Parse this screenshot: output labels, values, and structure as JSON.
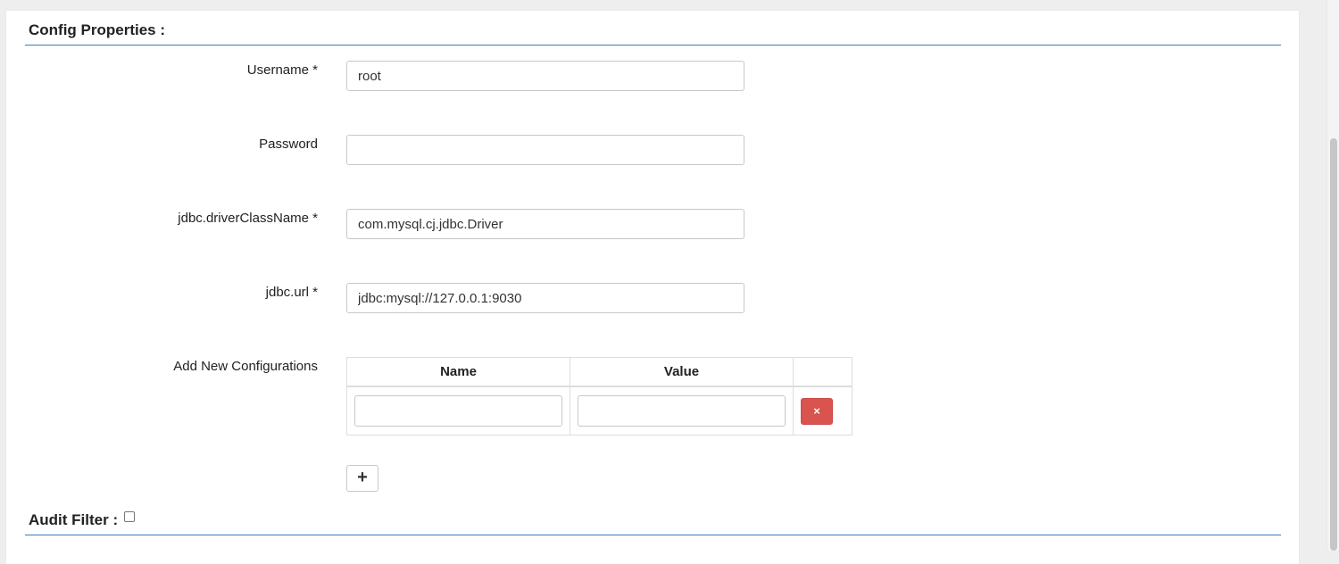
{
  "sections": {
    "config_title": "Config Properties :",
    "audit_title": "Audit Filter :"
  },
  "form": {
    "username": {
      "label": "Username *",
      "value": "root"
    },
    "password": {
      "label": "Password",
      "value": ""
    },
    "driver": {
      "label": "jdbc.driverClassName *",
      "value": "com.mysql.cj.jdbc.Driver"
    },
    "url": {
      "label": "jdbc.url *",
      "value": "jdbc:mysql://127.0.0.1:9030"
    },
    "new_configs": {
      "label": "Add New Configurations"
    }
  },
  "config_table": {
    "headers": [
      "Name",
      "Value"
    ],
    "rows": [
      {
        "name": "",
        "value": ""
      }
    ]
  },
  "buttons": {
    "delete_icon": "×",
    "add_icon": "+"
  },
  "audit_filter": {
    "checked": false
  },
  "colors": {
    "accent_rule": "#3a7bbf",
    "danger": "#d9534f"
  }
}
